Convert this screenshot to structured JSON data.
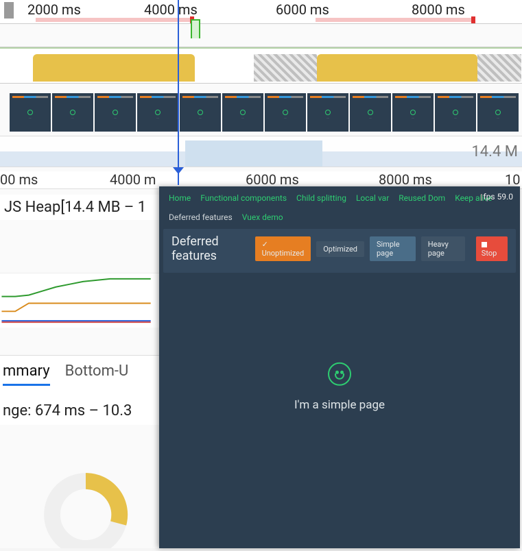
{
  "ruler": {
    "ticks": [
      "2000 ms",
      "4000 ms",
      "6000 ms",
      "8000 ms"
    ]
  },
  "ruler2": {
    "ticks": [
      "00 ms",
      "4000 m",
      "6000 ms",
      "8000 ms",
      "10"
    ]
  },
  "memory_label": "14.4 M",
  "jsheap_label": "JS Heap[14.4 MB – 1",
  "tabs": {
    "summary": "mmary",
    "bottom_up": "Bottom-U"
  },
  "range_label": "nge: 674 ms – 10.3",
  "chart_data": {
    "type": "line",
    "x": [
      0,
      20,
      40,
      60,
      80,
      100,
      120,
      140,
      160,
      180,
      200,
      220
    ],
    "series": [
      {
        "name": "green",
        "color": "#2e9a2e",
        "values": [
          34,
          34,
          32,
          26,
          20,
          16,
          12,
          10,
          8,
          8,
          8,
          8
        ]
      },
      {
        "name": "orange",
        "color": "#d98b1c",
        "values": [
          56,
          56,
          44,
          44,
          44,
          44,
          44,
          44,
          44,
          44,
          44,
          44
        ]
      },
      {
        "name": "blue",
        "color": "#2a5fd8",
        "values": [
          70,
          70,
          70,
          70,
          70,
          70,
          70,
          70,
          70,
          70,
          70,
          70
        ]
      },
      {
        "name": "red",
        "color": "#d14a4a",
        "values": [
          72,
          72,
          72,
          72,
          72,
          72,
          72,
          72,
          72,
          72,
          72,
          72
        ]
      }
    ]
  },
  "popup": {
    "nav": [
      "Home",
      "Functional components",
      "Child splitting",
      "Local var",
      "Reused Dom",
      "Keep alive",
      "Deferred features",
      "Vuex demo"
    ],
    "nav_current": "Deferred features",
    "fps": "fps 59.0",
    "title": "Deferred features",
    "buttons": {
      "unoptimized": "Unoptimized",
      "optimized": "Optimized",
      "simple": "Simple page",
      "heavy": "Heavy page",
      "stop": "Stop"
    },
    "message": "I'm a simple page"
  }
}
